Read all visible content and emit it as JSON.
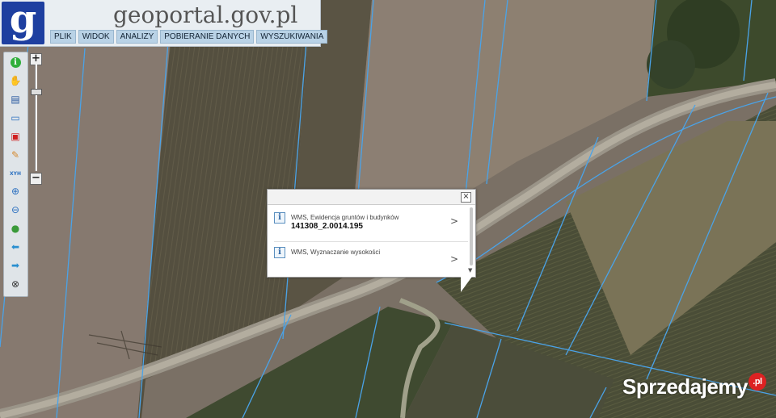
{
  "header": {
    "logo_letter": "g",
    "site_title": "geoportal.gov.pl"
  },
  "menu": [
    {
      "label": "PLIK"
    },
    {
      "label": "WIDOK"
    },
    {
      "label": "ANALIZY"
    },
    {
      "label": "POBIERANIE DANYCH"
    },
    {
      "label": "WYSZUKIWANIA"
    }
  ],
  "toolbar": {
    "tools": [
      {
        "icon": "info-icon",
        "glyph": "i"
      },
      {
        "icon": "hand-pan-icon",
        "glyph": "✋"
      },
      {
        "icon": "layers-list-icon",
        "glyph": "▤"
      },
      {
        "icon": "select-area-icon",
        "glyph": "▭"
      },
      {
        "icon": "select-object-icon",
        "glyph": "▣"
      },
      {
        "icon": "pencil-icon",
        "glyph": "✎"
      },
      {
        "icon": "xyh-coordinates-icon",
        "glyph": "XYH"
      },
      {
        "icon": "zoom-in-icon",
        "glyph": "⊕"
      },
      {
        "icon": "zoom-out-icon",
        "glyph": "⊖"
      },
      {
        "icon": "globe-icon",
        "glyph": "●"
      },
      {
        "icon": "back-arrow-icon",
        "glyph": "⬅"
      },
      {
        "icon": "forward-arrow-icon",
        "glyph": "➡"
      },
      {
        "icon": "clear-icon",
        "glyph": "⊗"
      }
    ]
  },
  "zoom": {
    "plus": "+",
    "minus": "−",
    "level": 0.25
  },
  "popup": {
    "close": "×",
    "entries": [
      {
        "title": "WMS, Ewidencja gruntów i budynków",
        "value": "141308_2.0014.195",
        "chevron": ">"
      },
      {
        "title": "WMS, Wyznaczanie wysokości",
        "value": "",
        "chevron": ">"
      }
    ]
  },
  "watermark": {
    "text": "Sprzedajemy",
    "suffix": ".pl"
  },
  "colors": {
    "logo_blue": "#1e3fa0",
    "parcel_line": "#4aa3e8",
    "menu_bg": "#b9d2e6"
  }
}
